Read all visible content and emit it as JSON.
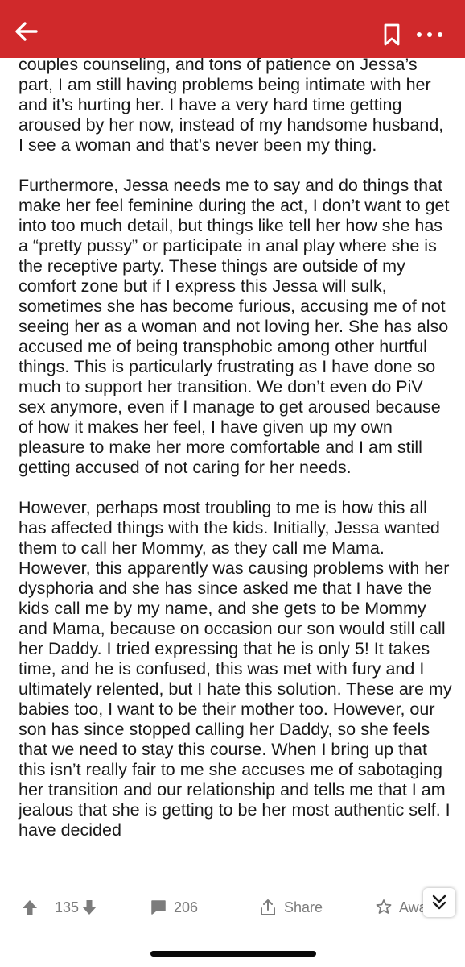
{
  "header": {
    "back_icon": "back-arrow-icon",
    "bookmark_icon": "bookmark-icon",
    "more_icon": "more-dots-icon",
    "color": "#d0292b"
  },
  "post": {
    "paragraphs": [
      "couples counseling, and tons of patience on Jessa’s part, I am still having problems being intimate with her and it’s hurting her. I have a very hard time getting aroused by her now, instead of my handsome husband, I see a woman and that’s never been my thing.",
      "Furthermore, Jessa needs me to say and do things that make her feel feminine during the act, I don’t want to get into too much detail, but things like tell her how she has a “pretty pussy” or participate in anal play where she is the receptive party. These things are outside of my comfort zone but if I express this Jessa will sulk, sometimes she has become furious, accusing me of not seeing her as a woman and not loving her. She has also accused me of being transphobic among other hurtful things. This is particularly frustrating as I have done so much to support her transition. We don’t even do PiV sex anymore, even if I manage to get aroused because of how it makes her feel, I have given up my own pleasure to make her more comfortable and I am still getting accused of not caring for her needs.",
      "However, perhaps most troubling to me is how this all has affected things with the kids. Initially, Jessa wanted them to call her Mommy, as they call me Mama. However, this apparently was causing problems with her dysphoria and she has since asked me that I have the kids call me by my name, and she gets to be Mommy and Mama, because on occasion our son would still call her Daddy. I tried expressing that he is only 5! It takes time, and he is confused, this was met with fury and I ultimately relented, but I hate this solution. These are my babies too, I want to be their mother too. However, our son has since stopped calling her Daddy, so she feels that we need to stay this course.  When I bring up that this isn’t really fair to me she accuses me of sabotaging her transition and our relationship and tells me that I am jealous that she is getting to be her most authentic self. I have decided"
    ]
  },
  "actions": {
    "upvote_icon": "upvote-arrow-icon",
    "score": "135",
    "downvote_icon": "downvote-arrow-icon",
    "comment_icon": "comment-icon",
    "comments": "206",
    "share_icon": "share-icon",
    "share_label": "Share",
    "award_icon": "award-icon",
    "award_label": "Awa",
    "expand_icon": "double-chevron-down-icon"
  }
}
